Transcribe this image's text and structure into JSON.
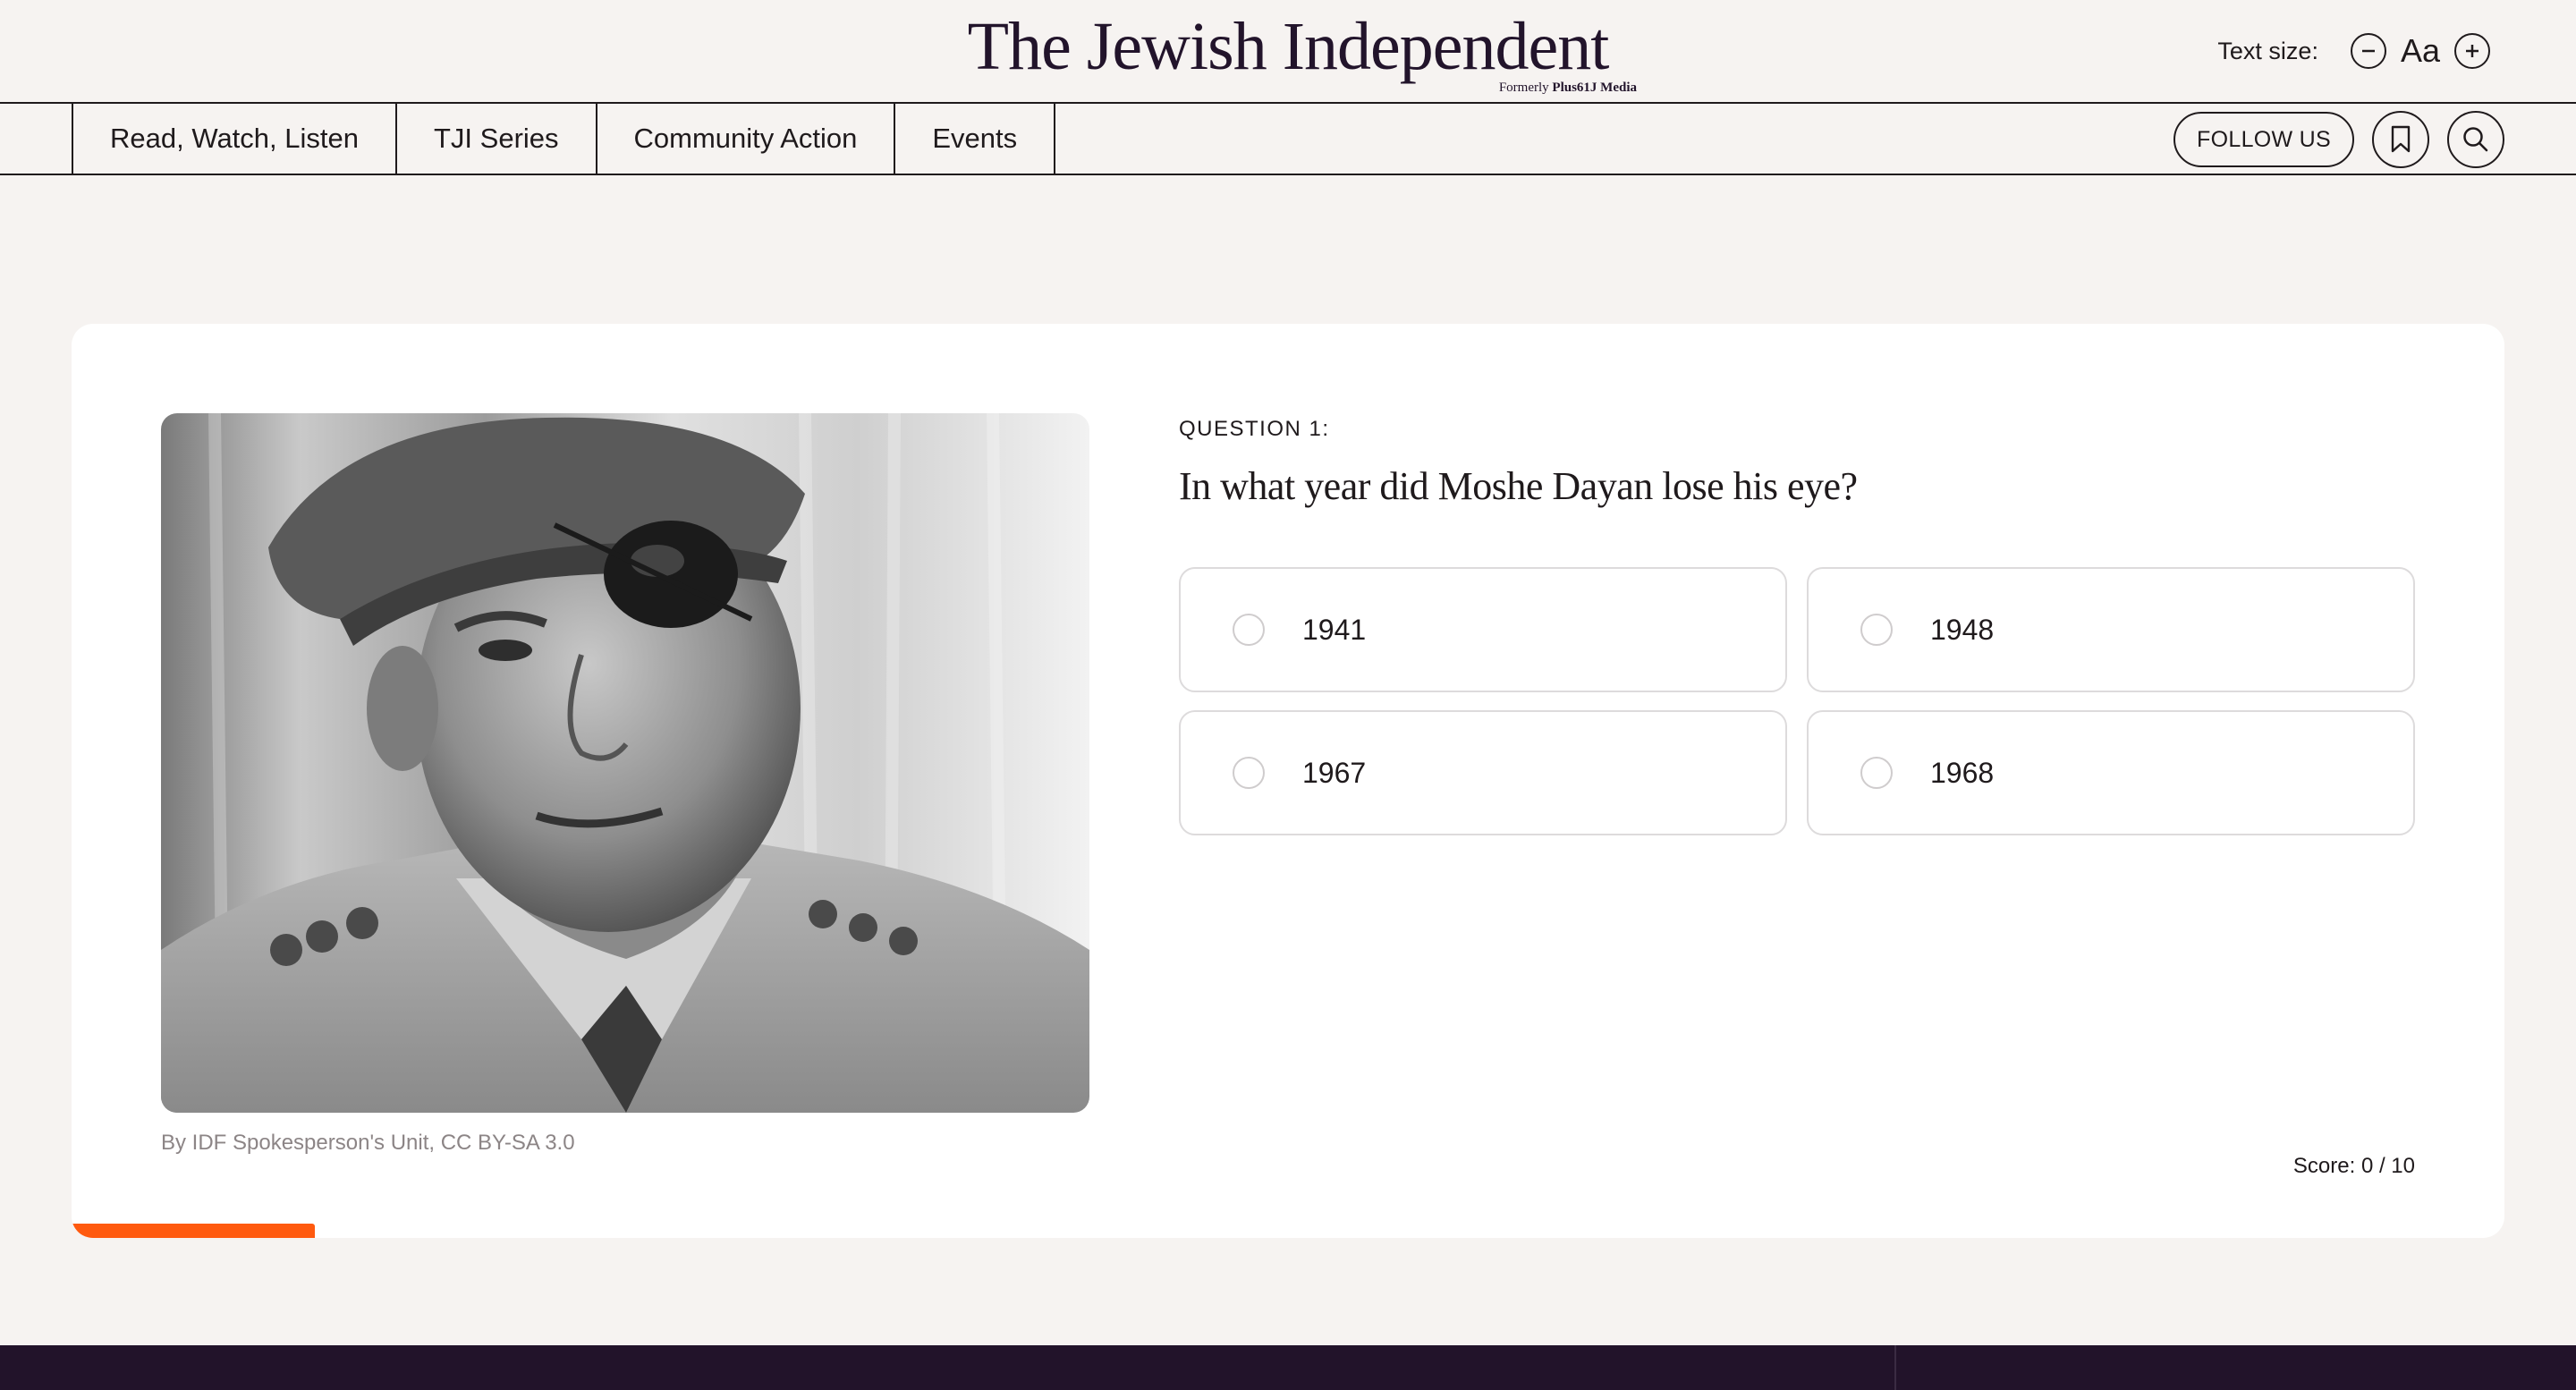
{
  "brand": {
    "title": "The Jewish Independent",
    "formerly_prefix": "Formerly",
    "formerly_name": "Plus61J Media",
    "accent": "#ff5a1f",
    "ink": "#22142b"
  },
  "text_size": {
    "label": "Text size:",
    "sample": "Aa",
    "decrease_icon": "minus-circle-icon",
    "increase_icon": "plus-circle-icon"
  },
  "nav": {
    "items": [
      {
        "label": "Read, Watch, Listen"
      },
      {
        "label": "TJI Series"
      },
      {
        "label": "Community Action"
      },
      {
        "label": "Events"
      }
    ],
    "follow_label": "FOLLOW US",
    "bookmark_icon": "bookmark-icon",
    "search_icon": "search-icon"
  },
  "quiz": {
    "question_number": "QUESTION 1:",
    "question_text": "In what year did Moshe Dayan lose his eye?",
    "answers": [
      {
        "label": "1941"
      },
      {
        "label": "1948"
      },
      {
        "label": "1967"
      },
      {
        "label": "1968"
      }
    ],
    "image_credit": "By IDF Spokesperson's Unit, CC BY-SA 3.0",
    "score_text": "Score: 0 / 10",
    "progress_fraction": 0.1,
    "progress_color": "#ff5a0f"
  },
  "footer": {
    "background": "#22132a"
  }
}
